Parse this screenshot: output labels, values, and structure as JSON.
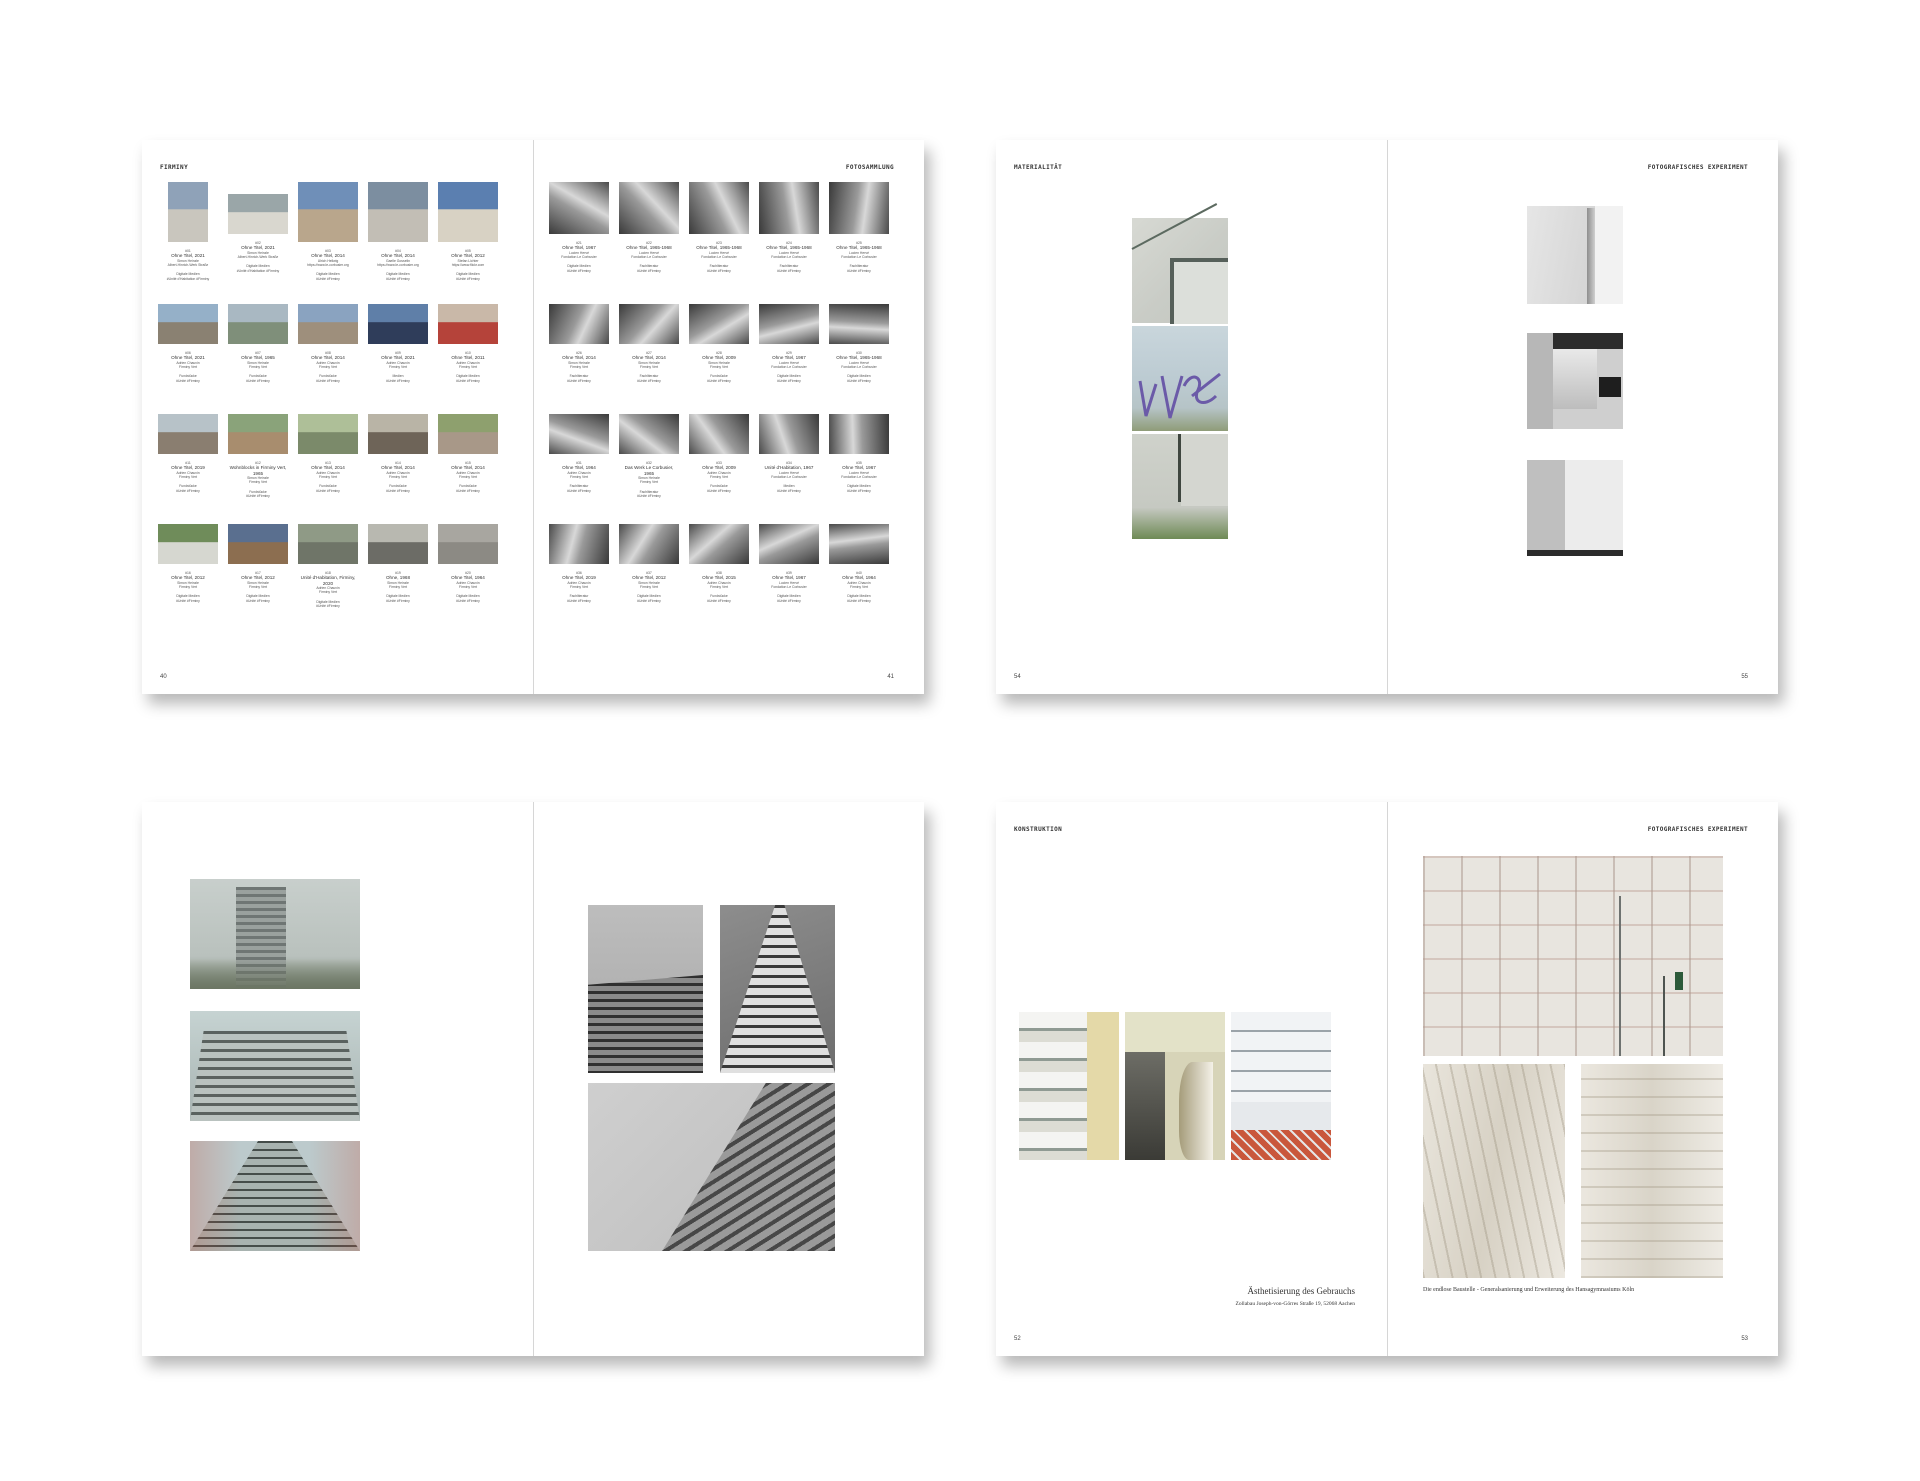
{
  "spreads": [
    {
      "left": {
        "header": "FIRMINY",
        "page_number": "40"
      },
      "right": {
        "header": "FOTOSAMMLUNG",
        "page_number": "41"
      }
    },
    {
      "left": {
        "header": "MATERIALITÄT",
        "page_number": "54"
      },
      "right": {
        "header": "FOTOGRAFISCHES EXPERIMENT",
        "page_number": "55"
      }
    },
    {
      "left": {
        "header": "",
        "page_number": ""
      },
      "right": {
        "header": "",
        "page_number": ""
      }
    },
    {
      "left": {
        "header": "KONSTRUKTION",
        "page_number": "52",
        "caption_title": "Ästhetisierung des Gebrauchs",
        "caption_sub": "Zollabau Joseph-von-Görres Straße 19, 52068 Aachen"
      },
      "right": {
        "header": "FOTOGRAFISCHES EXPERIMENT",
        "page_number": "53",
        "caption": "Die endlose Baustelle - Generalsanierung und Erweiterung des Hansagymnasiums Köln"
      }
    }
  ],
  "catalog_left": [
    {
      "code": "#01",
      "title": "Ohne Titel, 2021",
      "line1": "Simon Heinzle",
      "line2": "Albert-Hinrich-Werk Straße",
      "src": "Digitale Medien",
      "tag": "#Unité d'Habitation #Firminy"
    },
    {
      "code": "#02",
      "title": "Ohne Titel, 2021",
      "line1": "Simon Heinzle",
      "line2": "Albert-Hinrich-Werk Straße",
      "src": "Digitale Medien",
      "tag": "#Unité d'Habitation #Firminy"
    },
    {
      "code": "#03",
      "title": "Ohne Titel, 2014",
      "line1": "Ulrich Hellwig",
      "line2": "https://www.le-corbusier.org",
      "src": "Digitale Medien",
      "tag": "#Unité #Firminy"
    },
    {
      "code": "#04",
      "title": "Ohne Titel, 2014",
      "line1": "Gaelle Gosselin",
      "line2": "https://www.le-corbusier.org",
      "src": "Digitale Medien",
      "tag": "#Unité #Firminy"
    },
    {
      "code": "#05",
      "title": "Ohne Titel, 2012",
      "line1": "Stefan Lichter",
      "line2": "https://www.flickr.com",
      "src": "Digitale Medien",
      "tag": "#Unité #Firminy"
    },
    {
      "code": "#06",
      "title": "Ohne Titel, 2021",
      "line1": "Adrien Chauvin",
      "line2": "Firminy Vert",
      "src": "Fundstücke",
      "tag": "#Unité #Firminy"
    },
    {
      "code": "#07",
      "title": "Ohne Titel, 1965",
      "line1": "Simon Heinzle",
      "line2": "Firminy Vert",
      "src": "Fundstücke",
      "tag": "#Unité #Firminy"
    },
    {
      "code": "#08",
      "title": "Ohne Titel, 2014",
      "line1": "Adrien Chauvin",
      "line2": "Firminy Vert",
      "src": "Fundstücke",
      "tag": "#Unité #Firminy"
    },
    {
      "code": "#09",
      "title": "Ohne Titel, 2021",
      "line1": "Adrien Chauvin",
      "line2": "Firminy Vert",
      "src": "Medien",
      "tag": "#Unité #Firminy"
    },
    {
      "code": "#10",
      "title": "Ohne Titel, 2011",
      "line1": "Adrien Chauvin",
      "line2": "Firminy Vert",
      "src": "Digitale Medien",
      "tag": "#Unité #Firminy"
    },
    {
      "code": "#11",
      "title": "Ohne Titel, 2019",
      "line1": "Adrien Chauvin",
      "line2": "Firminy Vert",
      "src": "Fundstücke",
      "tag": "#Unité #Firminy"
    },
    {
      "code": "#12",
      "title": "Wohnblocks in Firminy Vert, 1965",
      "line1": "Simon Heinzle",
      "line2": "Firminy Vert",
      "src": "Fundstücke",
      "tag": "#Unité #Firminy"
    },
    {
      "code": "#13",
      "title": "Ohne Titel, 2014",
      "line1": "Adrien Chauvin",
      "line2": "Firminy Vert",
      "src": "Fundstücke",
      "tag": "#Unité #Firminy"
    },
    {
      "code": "#14",
      "title": "Ohne Titel, 2014",
      "line1": "Adrien Chauvin",
      "line2": "Firminy Vert",
      "src": "Fundstücke",
      "tag": "#Unité #Firminy"
    },
    {
      "code": "#15",
      "title": "Ohne Titel, 2014",
      "line1": "Adrien Chauvin",
      "line2": "Firminy Vert",
      "src": "Fundstücke",
      "tag": "#Unité #Firminy"
    },
    {
      "code": "#16",
      "title": "Ohne Titel, 2012",
      "line1": "Simon Heinzle",
      "line2": "Firminy Vert",
      "src": "Digitale Medien",
      "tag": "#Unité #Firminy"
    },
    {
      "code": "#17",
      "title": "Ohne Titel, 2012",
      "line1": "Simon Heinzle",
      "line2": "Firminy Vert",
      "src": "Digitale Medien",
      "tag": "#Unité #Firminy"
    },
    {
      "code": "#18",
      "title": "Unité d'Habitation, Firminy, 2020",
      "line1": "Adrien Chauvin",
      "line2": "Firminy Vert",
      "src": "Digitale Medien",
      "tag": "#Unité #Firminy"
    },
    {
      "code": "#19",
      "title": "Ohne, 1968",
      "line1": "Simon Heinzle",
      "line2": "Firminy Vert",
      "src": "Digitale Medien",
      "tag": "#Unité #Firminy"
    },
    {
      "code": "#20",
      "title": "Ohne Titel, 1964",
      "line1": "Adrien Chauvin",
      "line2": "Firminy Vert",
      "src": "Digitale Medien",
      "tag": "#Unité #Firminy"
    }
  ],
  "catalog_right": [
    {
      "code": "#21",
      "title": "Ohne Titel, 1967",
      "line1": "Lucien Hervé",
      "line2": "Fondation Le Corbusier",
      "src": "Digitale Medien",
      "tag": "#Unité #Firminy"
    },
    {
      "code": "#22",
      "title": "Ohne Titel, 1965-1968",
      "line1": "Lucien Hervé",
      "line2": "Fondation Le Corbusier",
      "src": "Fachliteratur",
      "tag": "#Unité #Firminy"
    },
    {
      "code": "#23",
      "title": "Ohne Titel, 1965-1968",
      "line1": "Lucien Hervé",
      "line2": "Fondation Le Corbusier",
      "src": "Fachliteratur",
      "tag": "#Unité #Firminy"
    },
    {
      "code": "#24",
      "title": "Ohne Titel, 1965-1968",
      "line1": "Lucien Hervé",
      "line2": "Fondation Le Corbusier",
      "src": "Fachliteratur",
      "tag": "#Unité #Firminy"
    },
    {
      "code": "#25",
      "title": "Ohne Titel, 1965-1968",
      "line1": "Lucien Hervé",
      "line2": "Fondation Le Corbusier",
      "src": "Fachliteratur",
      "tag": "#Unité #Firminy"
    },
    {
      "code": "#26",
      "title": "Ohne Titel, 2014",
      "line1": "Simon Heinzle",
      "line2": "Firminy Vert",
      "src": "Fachliteratur",
      "tag": "#Unité #Firminy"
    },
    {
      "code": "#27",
      "title": "Ohne Titel, 2014",
      "line1": "Simon Heinzle",
      "line2": "Firminy Vert",
      "src": "Fachliteratur",
      "tag": "#Unité #Firminy"
    },
    {
      "code": "#28",
      "title": "Ohne Titel, 2009",
      "line1": "Simon Heinzle",
      "line2": "Firminy Vert",
      "src": "Fundstücke",
      "tag": "#Unité #Firminy"
    },
    {
      "code": "#29",
      "title": "Ohne Titel, 1967",
      "line1": "Lucien Hervé",
      "line2": "Fondation Le Corbusier",
      "src": "Digitale Medien",
      "tag": "#Unité #Firminy"
    },
    {
      "code": "#30",
      "title": "Ohne Titel, 1965-1968",
      "line1": "Lucien Hervé",
      "line2": "Fondation Le Corbusier",
      "src": "Digitale Medien",
      "tag": "#Unité #Firminy"
    },
    {
      "code": "#31",
      "title": "Ohne Titel, 1964",
      "line1": "Adrien Chauvin",
      "line2": "Firminy Vert",
      "src": "Fachliteratur",
      "tag": "#Unité #Firminy"
    },
    {
      "code": "#32",
      "title": "Das Werk Le Corbusier, 1965",
      "line1": "Simon Heinzle",
      "line2": "Firminy Vert",
      "src": "Fachliteratur",
      "tag": "#Unité #Firminy"
    },
    {
      "code": "#33",
      "title": "Ohne Titel, 2009",
      "line1": "Adrien Chauvin",
      "line2": "Firminy Vert",
      "src": "Fundstücke",
      "tag": "#Unité #Firminy"
    },
    {
      "code": "#34",
      "title": "Unité d'Habitation, 1967",
      "line1": "Lucien Hervé",
      "line2": "Fondation Le Corbusier",
      "src": "Medien",
      "tag": "#Unité #Firminy"
    },
    {
      "code": "#35",
      "title": "Ohne Titel, 1967",
      "line1": "Lucien Hervé",
      "line2": "Fondation Le Corbusier",
      "src": "Digitale Medien",
      "tag": "#Unité #Firminy"
    },
    {
      "code": "#36",
      "title": "Ohne Titel, 2019",
      "line1": "Adrien Chauvin",
      "line2": "Firminy Vert",
      "src": "Fachliteratur",
      "tag": "#Unité #Firminy"
    },
    {
      "code": "#37",
      "title": "Ohne Titel, 2012",
      "line1": "Simon Heinzle",
      "line2": "Firminy Vert",
      "src": "Digitale Medien",
      "tag": "#Unité #Firminy"
    },
    {
      "code": "#38",
      "title": "Ohne Titel, 2015",
      "line1": "Adrien Chauvin",
      "line2": "Firminy Vert",
      "src": "Fundstücke",
      "tag": "#Unité #Firminy"
    },
    {
      "code": "#39",
      "title": "Ohne Titel, 1967",
      "line1": "Lucien Hervé",
      "line2": "Fondation Le Corbusier",
      "src": "Digitale Medien",
      "tag": "#Unité #Firminy"
    },
    {
      "code": "#40",
      "title": "Ohne Titel, 1964",
      "line1": "Adrien Chauvin",
      "line2": "Firminy Vert",
      "src": "Digitale Medien",
      "tag": "#Unité #Firminy"
    }
  ]
}
